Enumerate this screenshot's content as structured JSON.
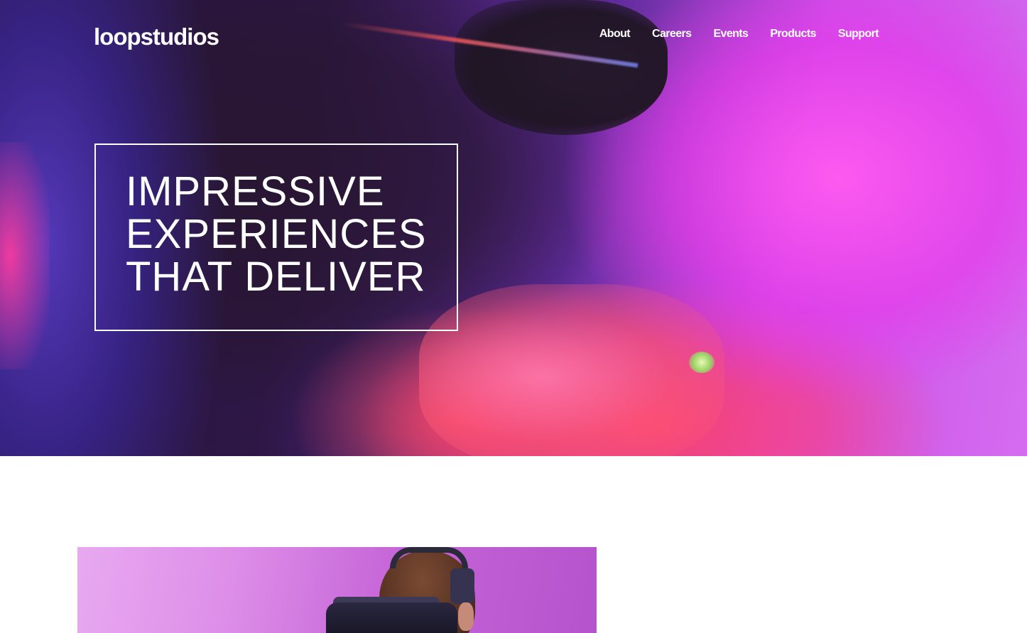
{
  "header": {
    "logo": "loopstudios",
    "nav": [
      "About",
      "Careers",
      "Events",
      "Products",
      "Support"
    ]
  },
  "hero": {
    "headline_lines": [
      "IMPRESSIVE",
      "EXPERIENCES",
      "THAT DELIVER"
    ]
  },
  "colors": {
    "text": "#ffffff",
    "page_background": "#ffffff"
  }
}
